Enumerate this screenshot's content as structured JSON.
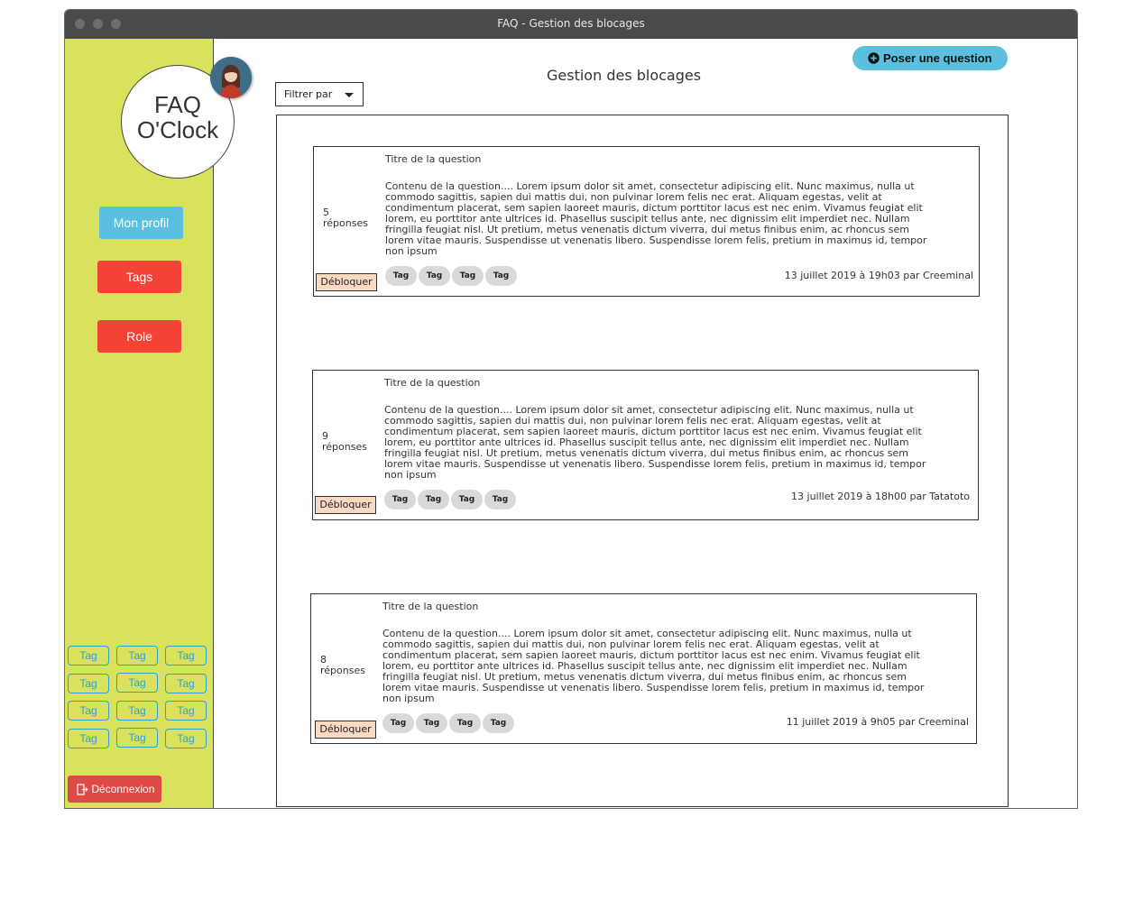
{
  "window": {
    "title": "FAQ - Gestion des blocages"
  },
  "sidebar": {
    "logo_line1": "FAQ",
    "logo_line2": "O'Clock",
    "profile_label": "Mon profil",
    "tags_label": "Tags",
    "role_label": "Role",
    "tag_grid": [
      "Tag",
      "Tag",
      "Tag",
      "Tag",
      "Tag",
      "Tag",
      "Tag",
      "Tag",
      "Tag",
      "Tag",
      "Tag",
      "Tag"
    ],
    "logout_label": "Déconnexion"
  },
  "header": {
    "title": "Gestion des blocages",
    "ask_label": "Poser une question",
    "filter_label": "Filtrer par"
  },
  "questions": [
    {
      "count": "5",
      "count_word": "réponses",
      "title": "Titre de la question",
      "body": "Contenu de la question.... Lorem ipsum dolor sit amet, consectetur adipiscing elit. Nunc maximus, nulla ut commodo sagittis, sapien dui mattis dui, non pulvinar lorem felis nec erat. Aliquam egestas, velit at condimentum placerat, sem sapien laoreet mauris, dictum porttitor lacus est nec enim. Vivamus feugiat elit lorem, eu porttitor ante ultrices id. Phasellus suscipit tellus ante, nec dignissim elit imperdiet nec. Nullam fringilla feugiat nisl. Ut pretium, metus venenatis dictum viverra, dui metus finibus enim, ac rhoncus sem lorem vitae mauris. Suspendisse ut venenatis libero. Suspendisse lorem felis, pretium in maximus id, tempor non ipsum",
      "tags": [
        "Tag",
        "Tag",
        "Tag",
        "Tag"
      ],
      "unlock_label": "Débloquer",
      "meta": "13 juillet 2019 à 19h03 par Creeminal"
    },
    {
      "count": "9",
      "count_word": "réponses",
      "title": "Titre de la question",
      "body": "Contenu de la question.... Lorem ipsum dolor sit amet, consectetur adipiscing elit. Nunc maximus, nulla ut commodo sagittis, sapien dui mattis dui, non pulvinar lorem felis nec erat. Aliquam egestas, velit at condimentum placerat, sem sapien laoreet mauris, dictum porttitor lacus est nec enim. Vivamus feugiat elit lorem, eu porttitor ante ultrices id. Phasellus suscipit tellus ante, nec dignissim elit imperdiet nec. Nullam fringilla feugiat nisl. Ut pretium, metus venenatis dictum viverra, dui metus finibus enim, ac rhoncus sem lorem vitae mauris. Suspendisse ut venenatis libero. Suspendisse lorem felis, pretium in maximus id, tempor non ipsum",
      "tags": [
        "Tag",
        "Tag",
        "Tag",
        "Tag"
      ],
      "unlock_label": "Débloquer",
      "meta": "13 juillet 2019 à 18h00 par Tatatoto"
    },
    {
      "count": "8",
      "count_word": "réponses",
      "title": "Titre de la question",
      "body": "Contenu de la question.... Lorem ipsum dolor sit amet, consectetur adipiscing elit. Nunc maximus, nulla ut commodo sagittis, sapien dui mattis dui, non pulvinar lorem felis nec erat. Aliquam egestas, velit at condimentum placerat, sem sapien laoreet mauris, dictum porttitor lacus est nec enim. Vivamus feugiat elit lorem, eu porttitor ante ultrices id. Phasellus suscipit tellus ante, nec dignissim elit imperdiet nec. Nullam fringilla feugiat nisl. Ut pretium, metus venenatis dictum viverra, dui metus finibus enim, ac rhoncus sem lorem vitae mauris. Suspendisse ut venenatis libero. Suspendisse lorem felis, pretium in maximus id, tempor non ipsum",
      "tags": [
        "Tag",
        "Tag",
        "Tag",
        "Tag"
      ],
      "unlock_label": "Débloquer",
      "meta": "11 juillet 2019 à 9h05 par Creeminal"
    }
  ],
  "colors": {
    "sidebar": "#d8e25d",
    "profile_button": "#5bc0e0",
    "red_button": "#f44336",
    "logout_button": "#e04a46",
    "tag_outline": "#2f9fd2",
    "unlock_bg": "#f9d9c1"
  },
  "icons": [
    "plus-circle-icon",
    "logout-icon",
    "avatar-icon",
    "dropdown-caret-icon"
  ]
}
